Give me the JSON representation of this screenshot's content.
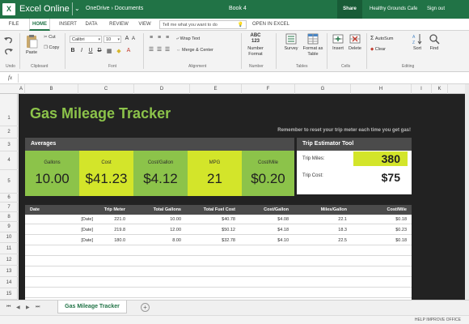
{
  "titlebar": {
    "app_name": "Excel Online",
    "logo": "X",
    "breadcrumb": "OneDrive › Documents",
    "document": "Book 4",
    "share_label": "Share",
    "owner": "Healthy Grounds Cafe",
    "signout_label": "Sign out"
  },
  "tabs": [
    "FILE",
    "HOME",
    "INSERT",
    "DATA",
    "REVIEW",
    "VIEW"
  ],
  "active_tab": "HOME",
  "tell_me": {
    "placeholder": "Tell me what you want to do"
  },
  "open_in_excel": "OPEN IN EXCEL",
  "ribbon": {
    "undo_label": "Undo",
    "paste_label": "Paste",
    "cut_label": "Cut",
    "copy_label": "Copy",
    "clipboard_label": "Clipboard",
    "font_name": "Calibri",
    "font_size": "10",
    "font_label": "Font",
    "bold": "B",
    "italic": "I",
    "underline": "U",
    "strike": "D",
    "wrap_text_label": "Wrap Text",
    "merge_label": "Merge & Center",
    "alignment_label": "Alignment",
    "number_format_label": "Number Format",
    "number_icon_text": "ABC 123",
    "number_label": "Number",
    "survey_label": "Survey",
    "format_table_label": "Format as Table",
    "tables_label": "Tables",
    "insert_label": "Insert",
    "delete_label": "Delete",
    "cells_label": "Cells",
    "autosum_label": "AutoSum",
    "clear_label": "Clear",
    "sort_label": "Sort",
    "find_label": "Find",
    "editing_label": "Editing"
  },
  "formula_bar": {
    "fx": "fx",
    "value": ""
  },
  "columns": [
    "A",
    "B",
    "C",
    "D",
    "E",
    "F",
    "G",
    "H",
    "I",
    "K"
  ],
  "rows": [
    "1",
    "2",
    "3",
    "4",
    "5",
    "6",
    "7",
    "8",
    "9",
    "10",
    "11",
    "12",
    "13",
    "14",
    "15"
  ],
  "sheet": {
    "title": "Gas Mileage Tracker",
    "reminder": "Remember to reset your trip meter each time you get gas!",
    "averages": {
      "header": "Averages",
      "tiles": [
        {
          "label": "Gallons",
          "value": "10.00",
          "color": "#8cc34a"
        },
        {
          "label": "Cost",
          "value": "$41.23",
          "color": "#d3e52a"
        },
        {
          "label": "Cost/Gallon",
          "value": "$4.12",
          "color": "#8cc34a"
        },
        {
          "label": "MPG",
          "value": "21",
          "color": "#d3e52a"
        },
        {
          "label": "Cost/Mile",
          "value": "$0.20",
          "color": "#8cc34a"
        }
      ]
    },
    "estimator": {
      "header": "Trip Estimator Tool",
      "trip_miles_label": "Trip Miles:",
      "trip_miles_value": "380",
      "trip_cost_label": "Trip Cost:",
      "trip_cost_value": "$75"
    },
    "log": {
      "headers": [
        "Date",
        "Trip Meter",
        "Total Gallons",
        "Total Fuel Cost",
        "Cost/Gallon",
        "Miles/Gallon",
        "Cost/Mile"
      ],
      "rows": [
        [
          "[Date]",
          "221.0",
          "10.00",
          "$40.78",
          "$4.08",
          "22.1",
          "$0.18"
        ],
        [
          "[Date]",
          "219.8",
          "12.00",
          "$50.12",
          "$4.18",
          "18.3",
          "$0.23"
        ],
        [
          "[Date]",
          "180.0",
          "8.00",
          "$32.78",
          "$4.10",
          "22.5",
          "$0.18"
        ],
        [
          "",
          "",
          "",
          "",
          "",
          "",
          ""
        ],
        [
          "",
          "",
          "",
          "",
          "",
          "",
          ""
        ],
        [
          "",
          "",
          "",
          "",
          "",
          "",
          ""
        ],
        [
          "",
          "",
          "",
          "",
          "",
          "",
          ""
        ],
        [
          "",
          "",
          "",
          "",
          "",
          "",
          ""
        ]
      ]
    }
  },
  "sheet_tab": "Gas Mileage Tracker",
  "add_sheet": "+",
  "status": {
    "help": "HELP IMPROVE OFFICE"
  },
  "colors": {
    "excel_green": "#217346",
    "sheet_bg": "#222222",
    "title_green": "#8cc34a",
    "lime": "#d3e52a"
  }
}
